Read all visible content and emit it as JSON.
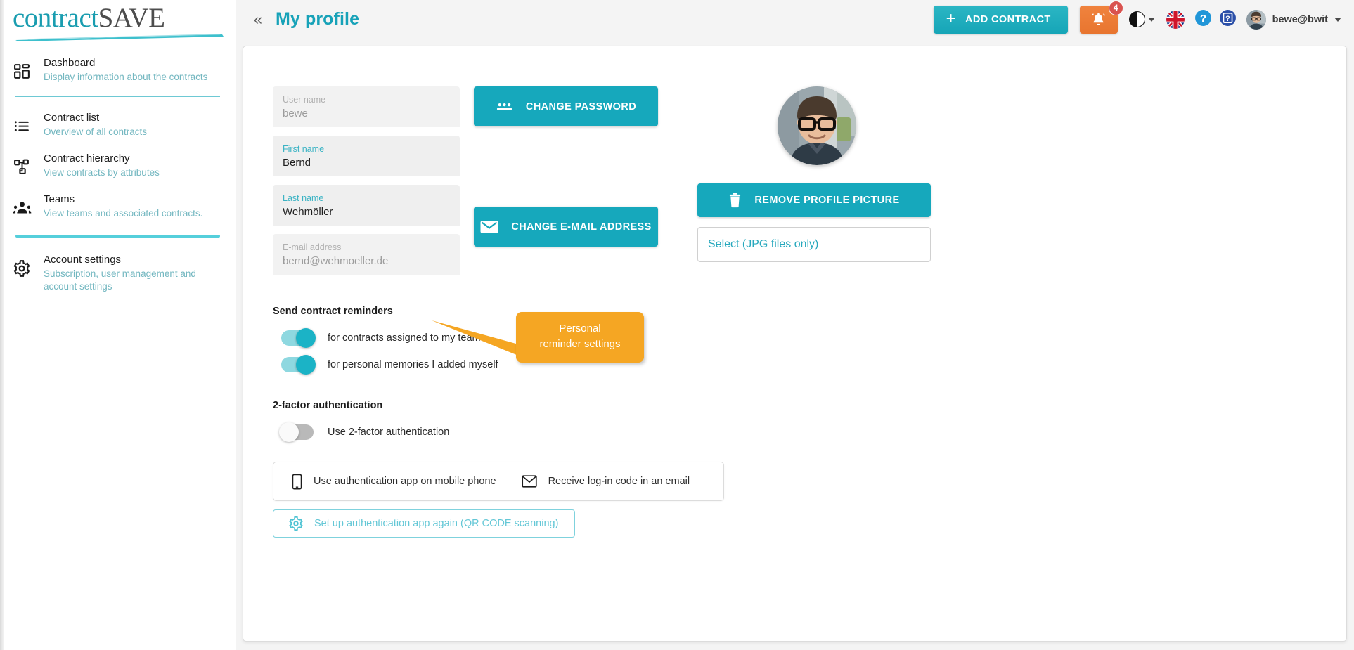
{
  "brand": {
    "logo_part1": "contract",
    "logo_part2": "SAVE",
    "accent_teal": "#16a8bc",
    "accent_orange": "#f0833e",
    "callout_orange": "#f5a623"
  },
  "sidebar": {
    "items": [
      {
        "icon": "dashboard-grid-icon",
        "title": "Dashboard",
        "subtitle": "Display information about the contracts"
      },
      {
        "icon": "list-icon",
        "title": "Contract list",
        "subtitle": "Overview of all contracts"
      },
      {
        "icon": "hierarchy-icon",
        "title": "Contract hierarchy",
        "subtitle": "View contracts by attributes"
      },
      {
        "icon": "people-icon",
        "title": "Teams",
        "subtitle": "View teams and associated contracts."
      },
      {
        "icon": "gear-icon",
        "title": "Account settings",
        "subtitle": "Subscription, user management and account settings"
      }
    ]
  },
  "header": {
    "collapse_icon": "«",
    "title": "My profile",
    "add_contract_label": "ADD CONTRACT",
    "add_contract_icon": "plus-icon",
    "notifications_icon": "bell-icon",
    "notifications_count": "4",
    "contrast_icon": "contrast-icon",
    "language_icon": "uk-flag-icon",
    "help_icon": "question-mark-icon",
    "info_icon": "info-box-icon",
    "user_name": "bewe@bwit",
    "user_avatar_icon": "avatar-icon",
    "user_caret_icon": "chevron-down-icon"
  },
  "profile": {
    "fields": [
      {
        "label": "User name",
        "value": "bewe",
        "readonly": true
      },
      {
        "label": "First name",
        "value": "Bernd",
        "readonly": false
      },
      {
        "label": "Last name",
        "value": "Wehmöller",
        "readonly": false
      },
      {
        "label": "E-mail address",
        "value": "bernd@wehmoeller.de",
        "readonly": true
      }
    ],
    "change_password_label": "CHANGE PASSWORD",
    "change_password_icon": "password-dots-icon",
    "change_email_label": "CHANGE E-MAIL ADDRESS",
    "change_email_icon": "envelope-icon",
    "remove_picture_label": "REMOVE PROFILE PICTURE",
    "remove_picture_icon": "trash-icon",
    "select_file_label": "Select (JPG files only)",
    "profile_picture_icon": "profile-photo"
  },
  "reminders": {
    "section_title": "Send contract reminders",
    "toggles": [
      {
        "label": "for contracts assigned to my teams",
        "state": "on"
      },
      {
        "label": "for personal memories I added myself",
        "state": "on"
      }
    ],
    "callout_line1": "Personal",
    "callout_line2": "reminder settings"
  },
  "twofactor": {
    "section_title": "2-factor authentication",
    "toggle_label": "Use 2-factor authentication",
    "toggle_state": "off",
    "options": [
      {
        "icon": "mobile-phone-icon",
        "label": "Use authentication app on mobile phone"
      },
      {
        "icon": "envelope-icon",
        "label": "Receive log-in code in an email"
      }
    ],
    "setup_label": "Set up authentication app again (QR CODE scanning)",
    "setup_icon": "gear-icon"
  }
}
